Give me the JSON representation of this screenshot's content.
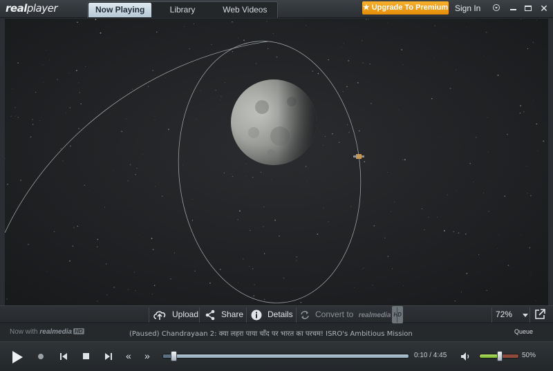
{
  "app": {
    "logo_text_real": "real",
    "logo_text_player": "player"
  },
  "tabs": [
    {
      "label": "Now Playing",
      "active": true
    },
    {
      "label": "Library",
      "active": false
    },
    {
      "label": "Web Videos",
      "active": false
    }
  ],
  "header": {
    "upgrade_label": "Upgrade To Premium",
    "upgrade_icon": "star-icon",
    "signin_label": "Sign In",
    "window_controls": [
      "menu-icon",
      "minimize-icon",
      "maximize-icon",
      "close-icon"
    ]
  },
  "actions": {
    "upload_label": "Upload",
    "share_label": "Share",
    "details_label": "Details",
    "convert_label": "Convert to",
    "convert_brand": "realmedia",
    "convert_hd": "HD",
    "zoom_value": "72%"
  },
  "info": {
    "now_with_label": "Now with",
    "brand": "realmedia",
    "brand_hd": "HD",
    "title": "(Paused) Chandrayaan 2: क्या लहरा पाया चाँद पर भारत का परचम! ISRO's Ambitious Mission",
    "queue_label": "Queue"
  },
  "playback": {
    "state": "paused",
    "current_time": "0:10",
    "separator": " / ",
    "duration": "4:45",
    "time_display": "0:10 / 4:45",
    "progress_fraction": 0.035,
    "volume_fraction": 0.5,
    "volume_label": "50%"
  },
  "colors": {
    "accent_orange": "#f0a01e",
    "active_tab": "#c9d8e4",
    "volume_green": "#8cc63f"
  }
}
